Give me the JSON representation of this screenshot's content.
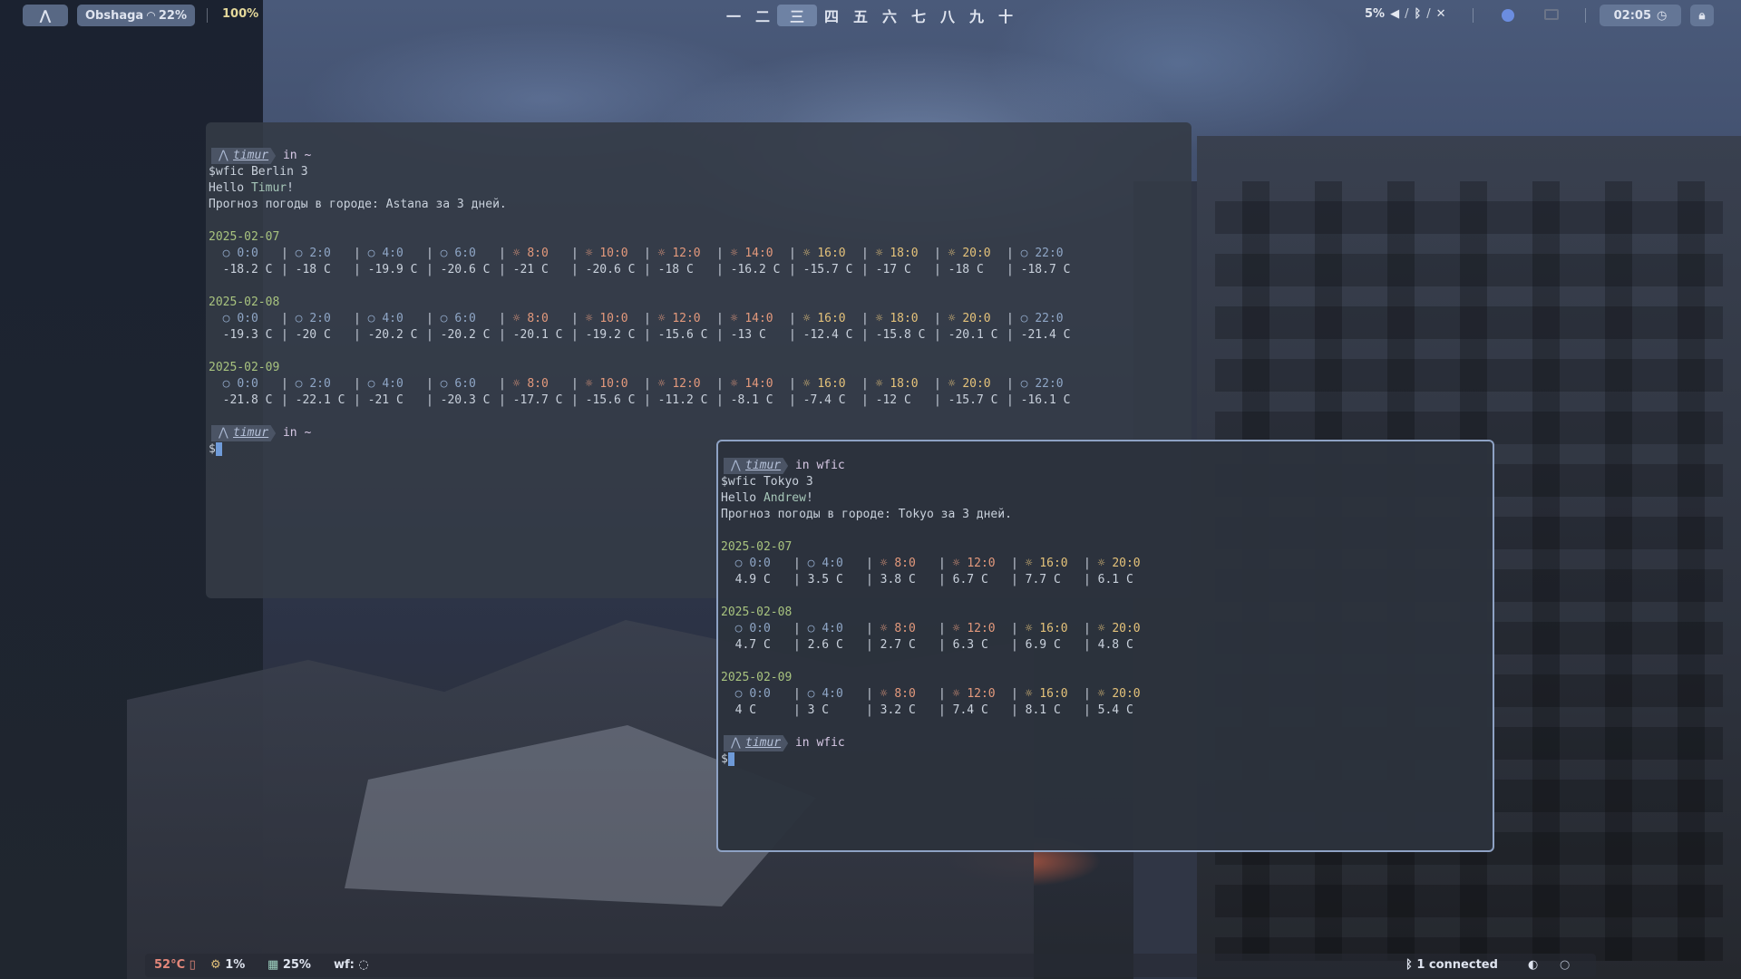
{
  "topbar": {
    "launcher_icon": "arch-icon",
    "network_name": "Obshaga",
    "wifi_icon": "wifi-icon",
    "battery": "22%",
    "brightness": "100%",
    "workspaces": [
      "一",
      "二",
      "三",
      "四",
      "五",
      "六",
      "七",
      "八",
      "九",
      "十"
    ],
    "active_workspace_index": 2,
    "volume": "5%",
    "clock": "02:05"
  },
  "term1": {
    "prompt_user": "timur",
    "prompt_dir": "in ~",
    "command": "$wfic Berlin 3",
    "hello_prefix": "Hello ",
    "hello_name": "Timur",
    "hello_suffix": "!",
    "forecast_line": "Прогноз погоды в городе: Astana за 3 дней.",
    "days": [
      {
        "date": "2025-02-07",
        "hours": [
          "0:0",
          "2:0",
          "4:0",
          "6:0",
          "8:0",
          "10:0",
          "12:0",
          "14:0",
          "16:0",
          "18:0",
          "20:0",
          "22:0"
        ],
        "temps": [
          "-18.2 C",
          "-18 C",
          "-19.9 C",
          "-20.6 C",
          "-21 C",
          "-20.6 C",
          "-18 C",
          "-16.2 C",
          "-15.7 C",
          "-17 C",
          "-18 C",
          "-18.7 C"
        ]
      },
      {
        "date": "2025-02-08",
        "hours": [
          "0:0",
          "2:0",
          "4:0",
          "6:0",
          "8:0",
          "10:0",
          "12:0",
          "14:0",
          "16:0",
          "18:0",
          "20:0",
          "22:0"
        ],
        "temps": [
          "-19.3 C",
          "-20 C",
          "-20.2 C",
          "-20.2 C",
          "-20.1 C",
          "-19.2 C",
          "-15.6 C",
          "-13 C",
          "-12.4 C",
          "-15.8 C",
          "-20.1 C",
          "-21.4 C"
        ]
      },
      {
        "date": "2025-02-09",
        "hours": [
          "0:0",
          "2:0",
          "4:0",
          "6:0",
          "8:0",
          "10:0",
          "12:0",
          "14:0",
          "16:0",
          "18:0",
          "20:0",
          "22:0"
        ],
        "temps": [
          "-21.8 C",
          "-22.1 C",
          "-21 C",
          "-20.3 C",
          "-17.7 C",
          "-15.6 C",
          "-11.2 C",
          "-8.1 C",
          "-7.4 C",
          "-12 C",
          "-15.7 C",
          "-16.1 C"
        ]
      }
    ],
    "prompt2_dir": "in ~",
    "input_prefix": "$"
  },
  "term2": {
    "prompt_user": "timur",
    "prompt_dir": "in wfic",
    "command": "$wfic Tokyo 3",
    "hello_prefix": "Hello ",
    "hello_name": "Andrew",
    "hello_suffix": "!",
    "forecast_line": "Прогноз погоды в городе: Tokyo за 3 дней.",
    "days": [
      {
        "date": "2025-02-07",
        "hours": [
          "0:0",
          "4:0",
          "8:0",
          "12:0",
          "16:0",
          "20:0"
        ],
        "temps": [
          "4.9 C",
          "3.5 C",
          "3.8 C",
          "6.7 C",
          "7.7 C",
          "6.1 C"
        ]
      },
      {
        "date": "2025-02-08",
        "hours": [
          "0:0",
          "4:0",
          "8:0",
          "12:0",
          "16:0",
          "20:0"
        ],
        "temps": [
          "4.7 C",
          "2.6 C",
          "2.7 C",
          "6.3 C",
          "6.9 C",
          "4.8 C"
        ]
      },
      {
        "date": "2025-02-09",
        "hours": [
          "0:0",
          "4:0",
          "8:0",
          "12:0",
          "16:0",
          "20:0"
        ],
        "temps": [
          "4 C",
          "3 C",
          "3.2 C",
          "7.4 C",
          "8.1 C",
          "5.4 C"
        ]
      }
    ],
    "prompt2_dir": "in wfic",
    "input_prefix": "$"
  },
  "bottombar": {
    "cpu_temp": "52°C",
    "cpu_load": "1%",
    "memory": "25%",
    "wf_label": "wf:",
    "bluetooth": "1 connected"
  },
  "colors": {
    "accent": "#8ea2c4",
    "date": "#a8c37f",
    "hour_warm": "#e3997c",
    "hour_sun": "#e4c27a",
    "hour_night": "#8fa6c6"
  }
}
